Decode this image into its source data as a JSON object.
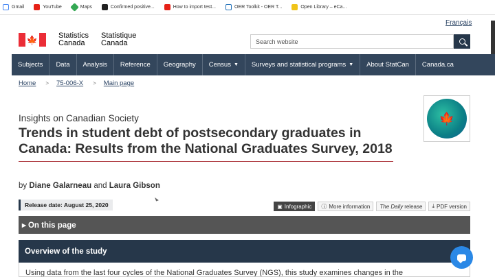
{
  "bookmarks": [
    {
      "label": "Gmail",
      "icon": "gmail-icon"
    },
    {
      "label": "YouTube",
      "icon": "youtube-icon"
    },
    {
      "label": "Maps",
      "icon": "maps-icon"
    },
    {
      "label": "Confirmed positive...",
      "icon": "github-icon"
    },
    {
      "label": "How to import test...",
      "icon": "youtube-icon"
    },
    {
      "label": "OER Toolkit - OER T...",
      "icon": "oer-icon"
    },
    {
      "label": "Open Library – eCa...",
      "icon": "library-icon"
    }
  ],
  "header": {
    "language_link": "Français",
    "wordmark_en_1": "Statistics",
    "wordmark_en_2": "Canada",
    "wordmark_fr_1": "Statistique",
    "wordmark_fr_2": "Canada",
    "search_placeholder": "Search website"
  },
  "nav": {
    "items": [
      {
        "label": "Subjects"
      },
      {
        "label": "Data"
      },
      {
        "label": "Analysis"
      },
      {
        "label": "Reference"
      },
      {
        "label": "Geography"
      },
      {
        "label": "Census"
      },
      {
        "label": "Surveys and statistical programs"
      },
      {
        "label": "About StatCan"
      },
      {
        "label": "Canada.ca"
      }
    ]
  },
  "breadcrumb": [
    "Home",
    "75-006-X",
    "Main page"
  ],
  "article": {
    "series": "Insights on Canadian Society",
    "title": "Trends in student debt of postsecondary graduates in Canada: Results from the National Graduates Survey, 2018",
    "by": "by",
    "author1": "Diane Galarneau",
    "and": "and",
    "author2": "Laura Gibson",
    "release": "Release date: August 25, 2020"
  },
  "tools": {
    "infographic": "Infographic",
    "more_info": "More information",
    "daily_italic": "The Daily",
    "daily_rest": "release",
    "pdf": "PDF version"
  },
  "on_this_page": "▸ On this page",
  "overview_title": "Overview of the study",
  "body_snippet": "Using data from the last four cycles of the National Graduates Survey (NGS), this study examines changes in the",
  "colors": {
    "nav_bg": "#33465c",
    "accent_red": "#af3c43",
    "overview_bg": "#26374a",
    "chat_blue": "#2a88e6"
  }
}
